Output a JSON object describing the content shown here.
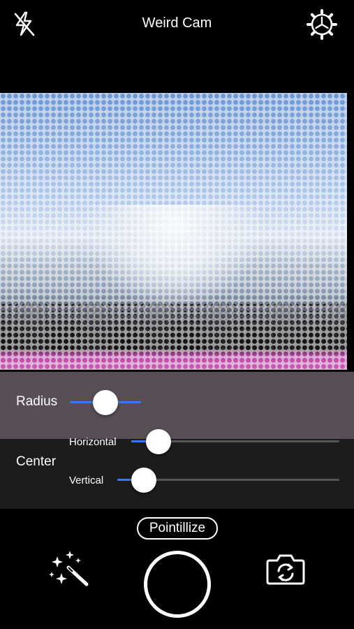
{
  "header": {
    "title": "Weird Cam"
  },
  "icons": {
    "flash": "flash-off-icon",
    "settings": "gear-icon",
    "effects": "magic-wand-icon",
    "flip": "camera-flip-icon"
  },
  "controls": {
    "radius": {
      "label": "Radius",
      "value": 0.5
    },
    "center": {
      "label": "Center",
      "horizontal": {
        "label": "Horizontal",
        "value": 0.13
      },
      "vertical": {
        "label": "Vertical",
        "value": 0.12
      }
    }
  },
  "filter": {
    "name": "Pointillize"
  },
  "colors": {
    "accent": "#2f7cf6",
    "background": "#000000",
    "text": "#ffffff"
  }
}
